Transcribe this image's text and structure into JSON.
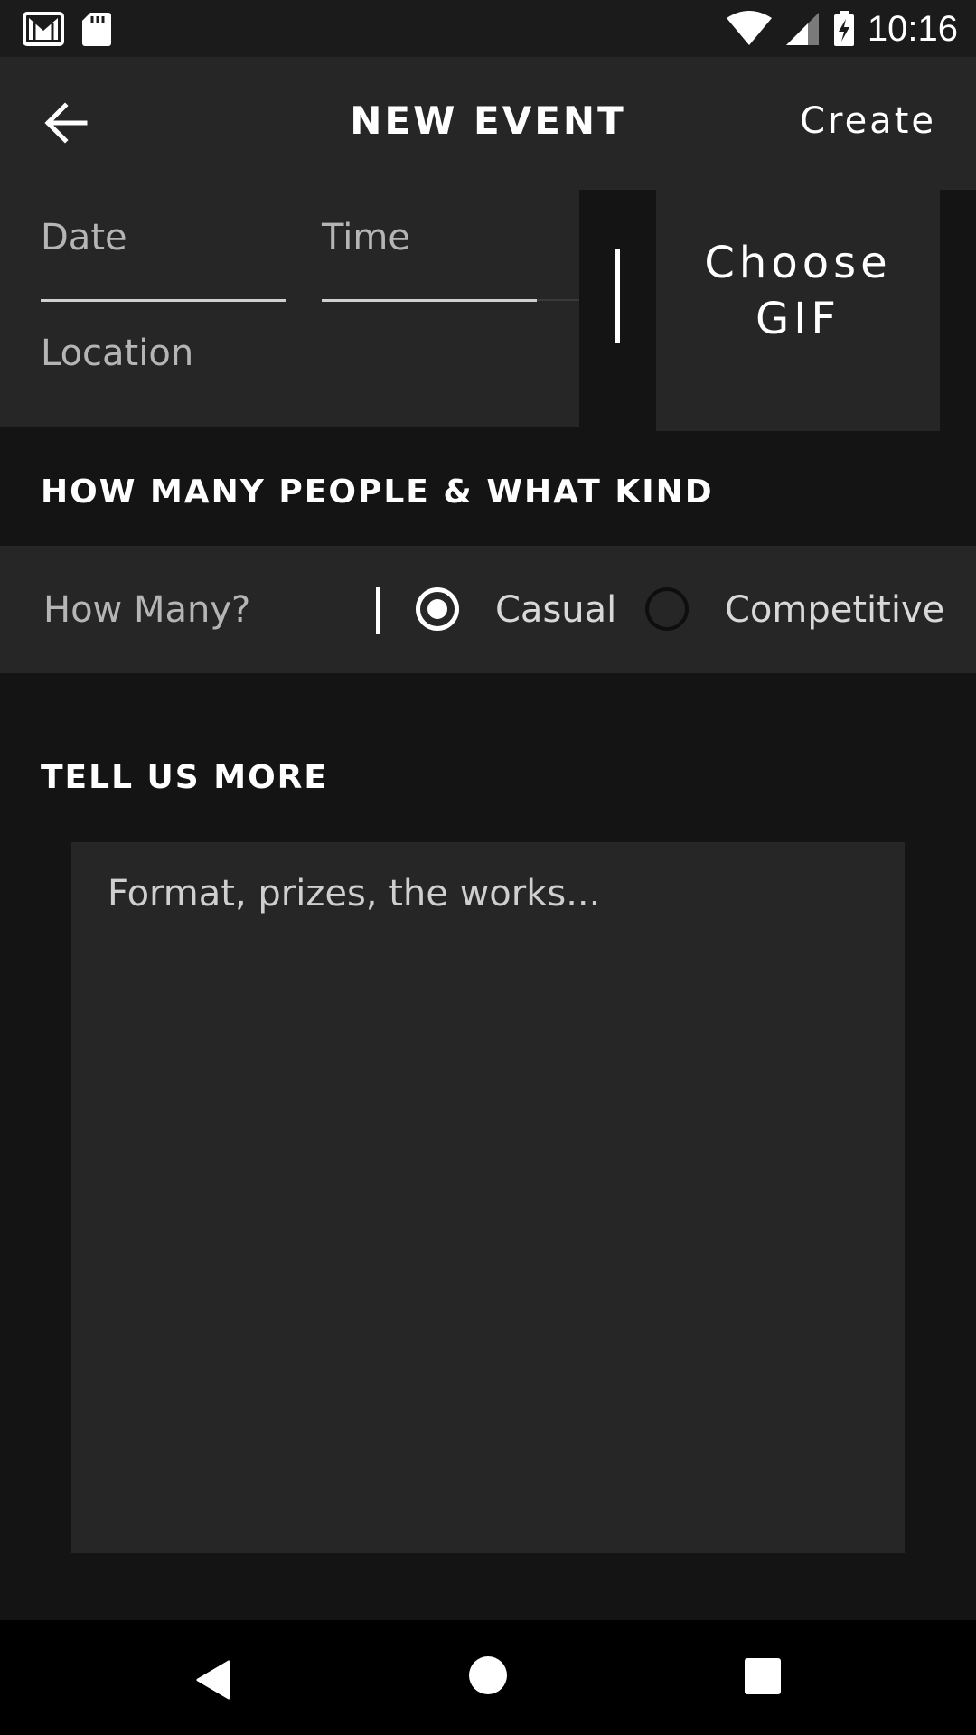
{
  "status_bar": {
    "time": "10:16",
    "icons": [
      "gmail-icon",
      "sd-card-icon",
      "wifi-icon",
      "signal-icon",
      "battery-charging-icon"
    ]
  },
  "app_bar": {
    "title": "NEW EVENT",
    "action_label": "Create",
    "back_icon": "arrow-left-icon"
  },
  "details": {
    "date_placeholder": "Date",
    "time_placeholder": "Time",
    "location_placeholder": "Location"
  },
  "gif": {
    "label_line1": "Choose",
    "label_line2": "GIF"
  },
  "people_section": {
    "heading": "HOW MANY PEOPLE & WHAT KIND",
    "how_many_placeholder": "How Many?",
    "options": [
      {
        "label": "Casual",
        "selected": true
      },
      {
        "label": "Competitive",
        "selected": false
      }
    ]
  },
  "more_section": {
    "heading": "TELL US MORE",
    "placeholder": "Format, prizes, the works..."
  },
  "colors": {
    "background": "#141414",
    "surface": "#262626",
    "text": "#ffffff",
    "hint_text": "#b5b5b5"
  }
}
